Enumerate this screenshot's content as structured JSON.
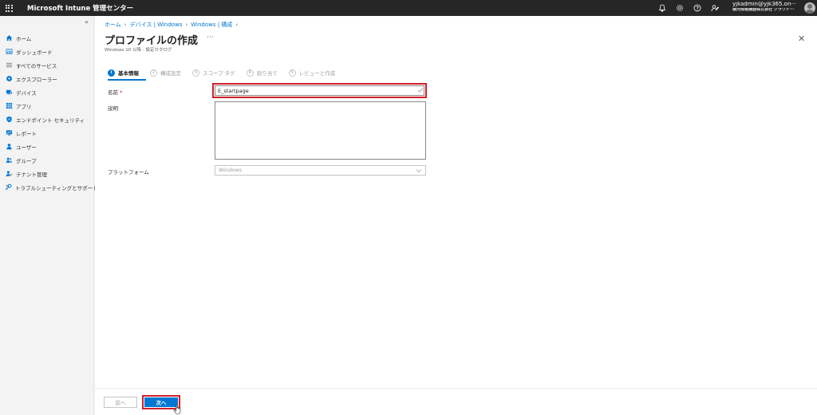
{
  "topbar": {
    "app_title": "Microsoft Intune 管理センター",
    "user_name": "yjkadmin@yjk365.on···",
    "user_org": "横河情報機器株式会社  クラウド···"
  },
  "sidebar": {
    "collapse_glyph": "«",
    "items": [
      {
        "label": "ホーム",
        "icon": "home-icon"
      },
      {
        "label": "ダッシュボード",
        "icon": "dashboard-icon"
      },
      {
        "label": "すべてのサービス",
        "icon": "all-services-icon"
      },
      {
        "label": "エクスプローラー",
        "icon": "explorer-icon"
      },
      {
        "label": "デバイス",
        "icon": "devices-icon"
      },
      {
        "label": "アプリ",
        "icon": "apps-icon"
      },
      {
        "label": "エンドポイント セキュリティ",
        "icon": "endpoint-security-icon"
      },
      {
        "label": "レポート",
        "icon": "reports-icon"
      },
      {
        "label": "ユーザー",
        "icon": "users-icon"
      },
      {
        "label": "グループ",
        "icon": "groups-icon"
      },
      {
        "label": "テナント管理",
        "icon": "tenant-admin-icon"
      },
      {
        "label": "トラブルシューティングとサポート",
        "icon": "troubleshoot-icon"
      }
    ]
  },
  "breadcrumb": [
    "ホーム",
    "デバイス | Windows",
    "Windows | 構成"
  ],
  "page": {
    "title": "プロファイルの作成",
    "more": "···",
    "subtitle": "Windows 10 以降 - 設定カタログ",
    "close_glyph": "✕"
  },
  "steps": [
    {
      "num": "✓",
      "label": "基本情報",
      "active": true
    },
    {
      "num": "2",
      "label": "構成設定",
      "active": false
    },
    {
      "num": "3",
      "label": "スコープ タグ",
      "active": false
    },
    {
      "num": "4",
      "label": "割り当て",
      "active": false
    },
    {
      "num": "5",
      "label": "レビューと作成",
      "active": false
    }
  ],
  "form": {
    "name_label": "名前",
    "required_mark": "*",
    "name_value": "E_startpage",
    "desc_label": "説明",
    "platform_label": "プラットフォーム",
    "platform_value": "Windows"
  },
  "footer": {
    "prev_label": "前へ",
    "next_label": "次へ"
  },
  "colors": {
    "accent": "#0078d4",
    "highlight": "#d01f2a",
    "topbar": "#262626"
  }
}
